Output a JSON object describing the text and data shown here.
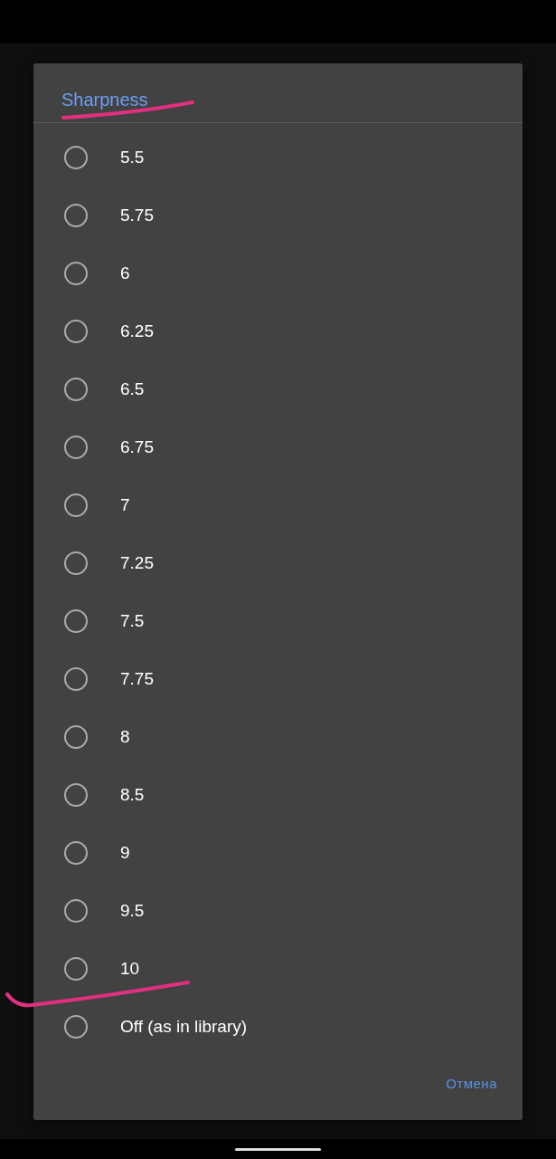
{
  "dialog": {
    "title": "Sharpness",
    "options": [
      {
        "label": "5.5",
        "selected": false
      },
      {
        "label": "5.75",
        "selected": false
      },
      {
        "label": "6",
        "selected": false
      },
      {
        "label": "6.25",
        "selected": false
      },
      {
        "label": "6.5",
        "selected": false
      },
      {
        "label": "6.75",
        "selected": false
      },
      {
        "label": "7",
        "selected": false
      },
      {
        "label": "7.25",
        "selected": false
      },
      {
        "label": "7.5",
        "selected": false
      },
      {
        "label": "7.75",
        "selected": false
      },
      {
        "label": "8",
        "selected": false
      },
      {
        "label": "8.5",
        "selected": false
      },
      {
        "label": "9",
        "selected": false
      },
      {
        "label": "9.5",
        "selected": false
      },
      {
        "label": "10",
        "selected": false
      },
      {
        "label": "Off (as in library)",
        "selected": false
      }
    ],
    "buttons": [
      "Отмена"
    ]
  }
}
